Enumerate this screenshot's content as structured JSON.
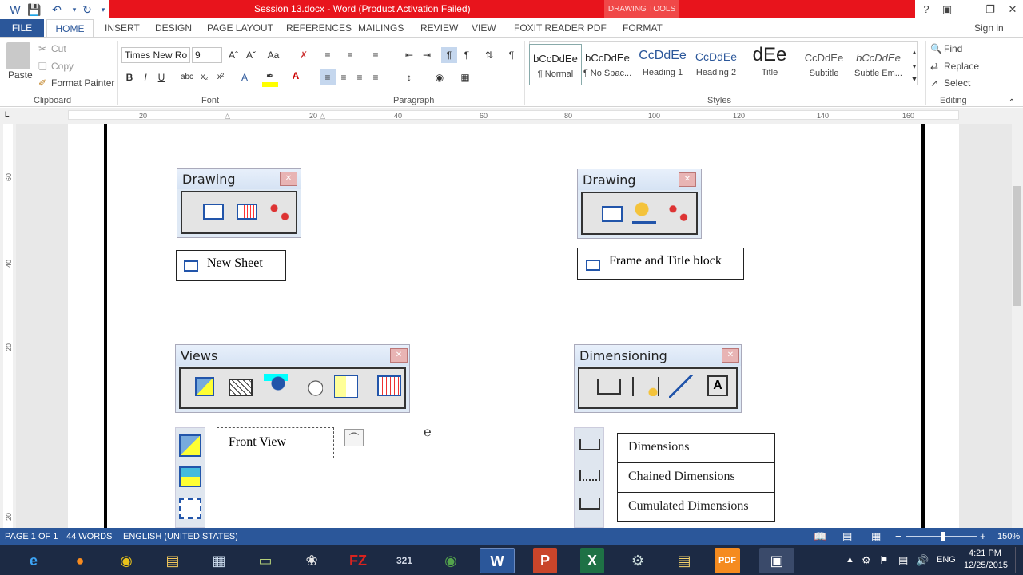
{
  "window": {
    "title": "Session 13.docx - Word (Product Activation Failed)",
    "context_tab": "DRAWING TOOLS",
    "help": "?",
    "sign_in": "Sign in"
  },
  "tabs": [
    "FILE",
    "HOME",
    "INSERT",
    "DESIGN",
    "PAGE LAYOUT",
    "REFERENCES",
    "MAILINGS",
    "REVIEW",
    "VIEW",
    "FOXIT READER PDF",
    "FORMAT"
  ],
  "ribbon": {
    "clipboard": {
      "paste": "Paste",
      "cut": "Cut",
      "copy": "Copy",
      "format_painter": "Format Painter",
      "label": "Clipboard"
    },
    "font": {
      "font_name": "Times New Ro",
      "font_size": "9",
      "label": "Font"
    },
    "paragraph": {
      "label": "Paragraph"
    },
    "styles": {
      "label": "Styles",
      "items": [
        {
          "sample": "bCcDdEe",
          "name": "¶ Normal"
        },
        {
          "sample": "bCcDdEe",
          "name": "¶ No Spac..."
        },
        {
          "sample": "CcDdEe",
          "name": "Heading 1"
        },
        {
          "sample": "CcDdEe",
          "name": "Heading 2"
        },
        {
          "sample": "dEe",
          "name": "Title"
        },
        {
          "sample": "CcDdEe",
          "name": "Subtitle"
        },
        {
          "sample": "bCcDdEe",
          "name": "Subtle Em..."
        }
      ]
    },
    "editing": {
      "find": "Find",
      "replace": "Replace",
      "select": "Select",
      "label": "Editing"
    }
  },
  "ruler": {
    "h_ticks": [
      "20",
      "20",
      "40",
      "60",
      "80",
      "100",
      "120",
      "140",
      "160"
    ],
    "v_ticks": [
      "60",
      "40",
      "20",
      "20"
    ]
  },
  "document": {
    "drawing_left": {
      "title": "Drawing",
      "label": "New Sheet"
    },
    "drawing_right": {
      "title": "Drawing",
      "label": "Frame and Title block"
    },
    "views": {
      "title": "Views",
      "label": "Front View"
    },
    "dimensioning": {
      "title": "Dimensioning",
      "list": [
        "Dimensions",
        "Chained Dimensions",
        "Cumulated Dimensions"
      ]
    }
  },
  "status": {
    "page": "PAGE 1 OF 1",
    "words": "44 WORDS",
    "language": "ENGLISH (UNITED STATES)",
    "zoom": "150%"
  },
  "taskbar": {
    "lang": "ENG",
    "time": "4:21 PM",
    "date": "12/25/2015"
  },
  "colors": {
    "word_blue": "#2b579a",
    "title_red": "#e8141c",
    "taskbar": "#1c2a44"
  }
}
